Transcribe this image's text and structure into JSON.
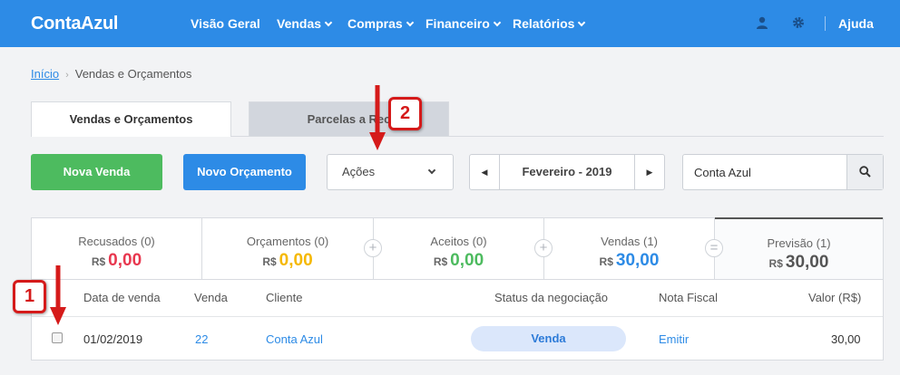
{
  "app": {
    "logo": "ContaAzul"
  },
  "nav": {
    "items": [
      {
        "label": "Visão Geral"
      },
      {
        "label": "Vendas"
      },
      {
        "label": "Compras"
      },
      {
        "label": "Financeiro"
      },
      {
        "label": "Relatórios"
      }
    ],
    "help": "Ajuda"
  },
  "breadcrumb": {
    "home": "Início",
    "current": "Vendas e Orçamentos"
  },
  "tabs": [
    {
      "label": "Vendas e Orçamentos",
      "active": true
    },
    {
      "label": "Parcelas a Rec",
      "active": false
    }
  ],
  "toolbar": {
    "new_sale": "Nova Venda",
    "new_quote": "Novo Orçamento",
    "actions": "Ações",
    "period": "Fevereiro - 2019",
    "search_value": "Conta Azul"
  },
  "stats": [
    {
      "label": "Recusados (0)",
      "currency": "R$",
      "value": "0,00",
      "color": "#e8384f"
    },
    {
      "label": "Orçamentos (0)",
      "currency": "R$",
      "value": "0,00",
      "color": "#f5b800"
    },
    {
      "label": "Aceitos (0)",
      "currency": "R$",
      "value": "0,00",
      "color": "#4dbb5f"
    },
    {
      "label": "Vendas (1)",
      "currency": "R$",
      "value": "30,00",
      "color": "#2d8be6"
    },
    {
      "label": "Previsão (1)",
      "currency": "R$",
      "value": "30,00",
      "color": "#555555"
    }
  ],
  "table": {
    "headers": {
      "date": "Data de venda",
      "sale": "Venda",
      "client": "Cliente",
      "status": "Status da negociação",
      "invoice": "Nota Fiscal",
      "value": "Valor (R$)"
    },
    "rows": [
      {
        "date": "01/02/2019",
        "sale": "22",
        "client": "Conta Azul",
        "status": "Venda",
        "invoice": "Emitir",
        "value": "30,00"
      }
    ]
  },
  "annotations": {
    "first": "1",
    "second": "2"
  }
}
